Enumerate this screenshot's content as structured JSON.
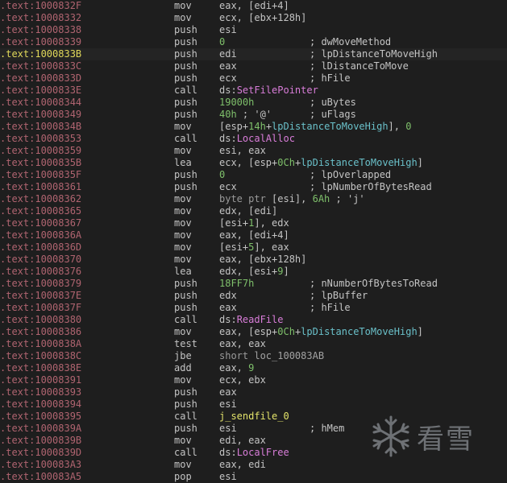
{
  "watermark": {
    "text": "看雪",
    "icon": "snowflake-icon"
  },
  "rows": [
    {
      "addr": ".text:1000832F",
      "mn": "mov",
      "ops": [
        [
          "t",
          "eax, [edi+4]"
        ]
      ],
      "cmt": ""
    },
    {
      "addr": ".text:10008332",
      "mn": "mov",
      "ops": [
        [
          "t",
          "ecx, [ebx+128h]"
        ]
      ],
      "cmt": ""
    },
    {
      "addr": ".text:10008338",
      "mn": "push",
      "ops": [
        [
          "t",
          "esi"
        ]
      ],
      "cmt": ""
    },
    {
      "addr": ".text:10008339",
      "mn": "push",
      "ops": [
        [
          "num",
          "0"
        ]
      ],
      "cmt": "; dwMoveMethod"
    },
    {
      "addr": ".text:1000833B",
      "mn": "push",
      "ops": [
        [
          "t",
          "edi"
        ]
      ],
      "cmt": "; lpDistanceToMoveHigh",
      "current": true
    },
    {
      "addr": ".text:1000833C",
      "mn": "push",
      "ops": [
        [
          "t",
          "eax"
        ]
      ],
      "cmt": "; lDistanceToMove"
    },
    {
      "addr": ".text:1000833D",
      "mn": "push",
      "ops": [
        [
          "t",
          "ecx"
        ]
      ],
      "cmt": "; hFile"
    },
    {
      "addr": ".text:1000833E",
      "mn": "call",
      "ops": [
        [
          "t",
          "ds:"
        ],
        [
          "ext",
          "SetFilePointer"
        ]
      ],
      "cmt": ""
    },
    {
      "addr": ".text:10008344",
      "mn": "push",
      "ops": [
        [
          "num",
          "19000h"
        ]
      ],
      "cmt": "; uBytes"
    },
    {
      "addr": ".text:10008349",
      "mn": "push",
      "ops": [
        [
          "num",
          "40h"
        ],
        [
          "t",
          " ; '@'"
        ]
      ],
      "cmt": "; uFlags"
    },
    {
      "addr": ".text:1000834B",
      "mn": "mov",
      "ops": [
        [
          "t",
          "[esp+"
        ],
        [
          "num",
          "14h"
        ],
        [
          "t",
          "+"
        ],
        [
          "var",
          "lpDistanceToMoveHigh"
        ],
        [
          "t",
          "], "
        ],
        [
          "num",
          "0"
        ]
      ],
      "cmt": ""
    },
    {
      "addr": ".text:10008353",
      "mn": "call",
      "ops": [
        [
          "t",
          "ds:"
        ],
        [
          "ext",
          "LocalAlloc"
        ]
      ],
      "cmt": ""
    },
    {
      "addr": ".text:10008359",
      "mn": "mov",
      "ops": [
        [
          "t",
          "esi, eax"
        ]
      ],
      "cmt": ""
    },
    {
      "addr": ".text:1000835B",
      "mn": "lea",
      "ops": [
        [
          "t",
          "ecx, [esp+"
        ],
        [
          "num",
          "0Ch"
        ],
        [
          "t",
          "+"
        ],
        [
          "var",
          "lpDistanceToMoveHigh"
        ],
        [
          "t",
          "]"
        ]
      ],
      "cmt": ""
    },
    {
      "addr": ".text:1000835F",
      "mn": "push",
      "ops": [
        [
          "num",
          "0"
        ]
      ],
      "cmt": "; lpOverlapped"
    },
    {
      "addr": ".text:10008361",
      "mn": "push",
      "ops": [
        [
          "t",
          "ecx"
        ]
      ],
      "cmt": "; lpNumberOfBytesRead"
    },
    {
      "addr": ".text:10008362",
      "mn": "mov",
      "ops": [
        [
          "dim",
          "byte ptr"
        ],
        [
          "t",
          " [esi], "
        ],
        [
          "num",
          "6Ah"
        ],
        [
          "t",
          " ; 'j'"
        ]
      ],
      "cmt": ""
    },
    {
      "addr": ".text:10008365",
      "mn": "mov",
      "ops": [
        [
          "t",
          "edx, [edi]"
        ]
      ],
      "cmt": ""
    },
    {
      "addr": ".text:10008367",
      "mn": "mov",
      "ops": [
        [
          "t",
          "[esi+"
        ],
        [
          "num",
          "1"
        ],
        [
          "t",
          "], edx"
        ]
      ],
      "cmt": ""
    },
    {
      "addr": ".text:1000836A",
      "mn": "mov",
      "ops": [
        [
          "t",
          "eax, [edi+4]"
        ]
      ],
      "cmt": ""
    },
    {
      "addr": ".text:1000836D",
      "mn": "mov",
      "ops": [
        [
          "t",
          "[esi+"
        ],
        [
          "num",
          "5"
        ],
        [
          "t",
          "], eax"
        ]
      ],
      "cmt": ""
    },
    {
      "addr": ".text:10008370",
      "mn": "mov",
      "ops": [
        [
          "t",
          "eax, [ebx+128h]"
        ]
      ],
      "cmt": ""
    },
    {
      "addr": ".text:10008376",
      "mn": "lea",
      "ops": [
        [
          "t",
          "edx, [esi+"
        ],
        [
          "num",
          "9"
        ],
        [
          "t",
          "]"
        ]
      ],
      "cmt": ""
    },
    {
      "addr": ".text:10008379",
      "mn": "push",
      "ops": [
        [
          "num",
          "18FF7h"
        ]
      ],
      "cmt": "; nNumberOfBytesToRead"
    },
    {
      "addr": ".text:1000837E",
      "mn": "push",
      "ops": [
        [
          "t",
          "edx"
        ]
      ],
      "cmt": "; lpBuffer"
    },
    {
      "addr": ".text:1000837F",
      "mn": "push",
      "ops": [
        [
          "t",
          "eax"
        ]
      ],
      "cmt": "; hFile"
    },
    {
      "addr": ".text:10008380",
      "mn": "call",
      "ops": [
        [
          "t",
          "ds:"
        ],
        [
          "ext",
          "ReadFile"
        ]
      ],
      "cmt": ""
    },
    {
      "addr": ".text:10008386",
      "mn": "mov",
      "ops": [
        [
          "t",
          "eax, [esp+"
        ],
        [
          "num",
          "0Ch"
        ],
        [
          "t",
          "+"
        ],
        [
          "var",
          "lpDistanceToMoveHigh"
        ],
        [
          "t",
          "]"
        ]
      ],
      "cmt": ""
    },
    {
      "addr": ".text:1000838A",
      "mn": "test",
      "ops": [
        [
          "t",
          "eax, eax"
        ]
      ],
      "cmt": ""
    },
    {
      "addr": ".text:1000838C",
      "mn": "jbe",
      "ops": [
        [
          "dim",
          "short"
        ],
        [
          "t",
          " "
        ],
        [
          "loc",
          "loc_100083AB"
        ]
      ],
      "cmt": ""
    },
    {
      "addr": ".text:1000838E",
      "mn": "add",
      "ops": [
        [
          "t",
          "eax, "
        ],
        [
          "num",
          "9"
        ]
      ],
      "cmt": ""
    },
    {
      "addr": ".text:10008391",
      "mn": "mov",
      "ops": [
        [
          "t",
          "ecx, ebx"
        ]
      ],
      "cmt": ""
    },
    {
      "addr": ".text:10008393",
      "mn": "push",
      "ops": [
        [
          "t",
          "eax"
        ]
      ],
      "cmt": ""
    },
    {
      "addr": ".text:10008394",
      "mn": "push",
      "ops": [
        [
          "t",
          "esi"
        ]
      ],
      "cmt": ""
    },
    {
      "addr": ".text:10008395",
      "mn": "call",
      "ops": [
        [
          "sub",
          "j_sendfile_0"
        ]
      ],
      "cmt": ""
    },
    {
      "addr": ".text:1000839A",
      "mn": "push",
      "ops": [
        [
          "t",
          "esi"
        ]
      ],
      "cmt": "; hMem"
    },
    {
      "addr": ".text:1000839B",
      "mn": "mov",
      "ops": [
        [
          "t",
          "edi, eax"
        ]
      ],
      "cmt": ""
    },
    {
      "addr": ".text:1000839D",
      "mn": "call",
      "ops": [
        [
          "t",
          "ds:"
        ],
        [
          "ext",
          "LocalFree"
        ]
      ],
      "cmt": ""
    },
    {
      "addr": ".text:100083A3",
      "mn": "mov",
      "ops": [
        [
          "t",
          "eax, edi"
        ]
      ],
      "cmt": ""
    },
    {
      "addr": ".text:100083A5",
      "mn": "pop",
      "ops": [
        [
          "t",
          "esi"
        ]
      ],
      "cmt": ""
    }
  ]
}
